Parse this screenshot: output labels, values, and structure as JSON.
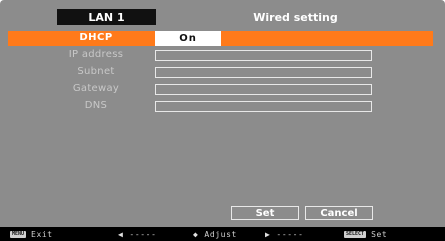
{
  "header": {
    "tab_label": "LAN 1",
    "title": "Wired setting"
  },
  "form": {
    "dhcp": {
      "label": "DHCP",
      "value": "On"
    },
    "ip_address": {
      "label": "IP address",
      "value": ""
    },
    "subnet": {
      "label": "Subnet",
      "value": ""
    },
    "gateway": {
      "label": "Gateway",
      "value": ""
    },
    "dns": {
      "label": "DNS",
      "value": ""
    }
  },
  "buttons": {
    "set": "Set",
    "cancel": "Cancel"
  },
  "statusbar": {
    "exit_key": "MENU",
    "exit_label": "Exit",
    "left_glyph": "◀",
    "left_label": "-----",
    "adjust_glyph": "◆",
    "adjust_label": "Adjust",
    "right_glyph": "▶",
    "right_label": "-----",
    "set_key": "SELECT",
    "set_label": "Set"
  },
  "colors": {
    "highlight": "#ff7a1a",
    "background": "#8c8c8c",
    "statusbar": "#000000"
  },
  "icons": {
    "exit": "menu-key-icon",
    "left": "left-arrow-icon",
    "adjust": "updown-arrow-icon",
    "right": "right-arrow-icon",
    "set": "select-key-icon"
  }
}
